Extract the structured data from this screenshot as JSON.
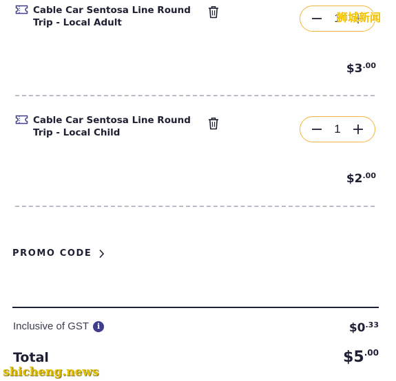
{
  "cart": {
    "items": [
      {
        "name": "Cable Car Sentosa Line Round Trip - Local Adult",
        "quantity": "1",
        "price_main": "$3",
        "price_cents": ".00"
      },
      {
        "name": "Cable Car Sentosa Line Round Trip - Local Child",
        "quantity": "1",
        "price_main": "$2",
        "price_cents": ".00"
      }
    ],
    "promo_label": "PROMO CODE",
    "gst_label": "Inclusive of GST",
    "gst_main": "$0",
    "gst_cents": ".33",
    "total_label": "Total",
    "total_main": "$5",
    "total_cents": ".00"
  },
  "icons": {
    "ticket": "ticket-icon",
    "trash": "trash-icon",
    "minus": "minus-icon",
    "plus": "plus-icon",
    "chevron": "chevron-right-icon",
    "info": "info-icon"
  },
  "colors": {
    "accent": "#f2b43a",
    "text": "#1d1f33",
    "info": "#3f3d8f",
    "divider": "#b9bcc6"
  },
  "watermark": {
    "chinese": "狮城新闻",
    "site": "shicheng.news"
  }
}
